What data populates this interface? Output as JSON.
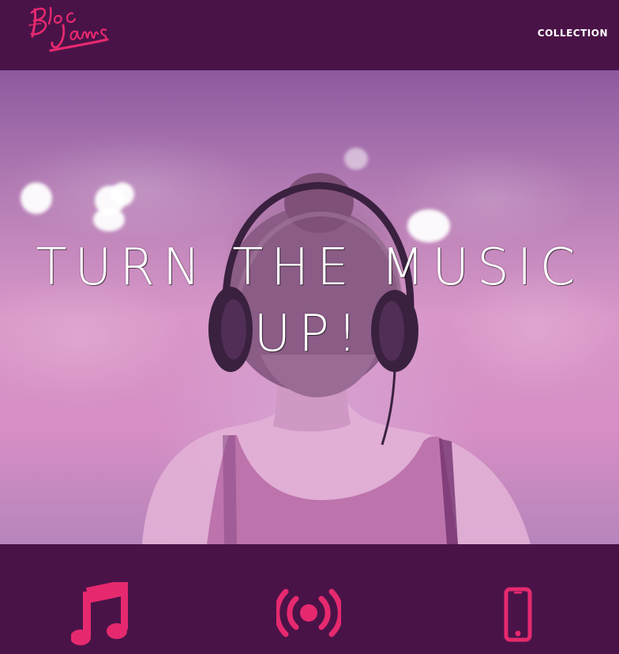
{
  "navbar": {
    "logo_text": "Bloc Jams",
    "links": [
      {
        "label": "COLLECTION"
      }
    ]
  },
  "hero": {
    "title": "TURN THE MUSIC UP!"
  },
  "features": [
    {
      "icon": "music-note-icon"
    },
    {
      "icon": "broadcast-icon"
    },
    {
      "icon": "mobile-phone-icon"
    }
  ],
  "colors": {
    "navbar_bg": "#4a1348",
    "accent_pink": "#e6296f",
    "hero_tint": "#d68ec4",
    "text_white": "#ffffff"
  }
}
